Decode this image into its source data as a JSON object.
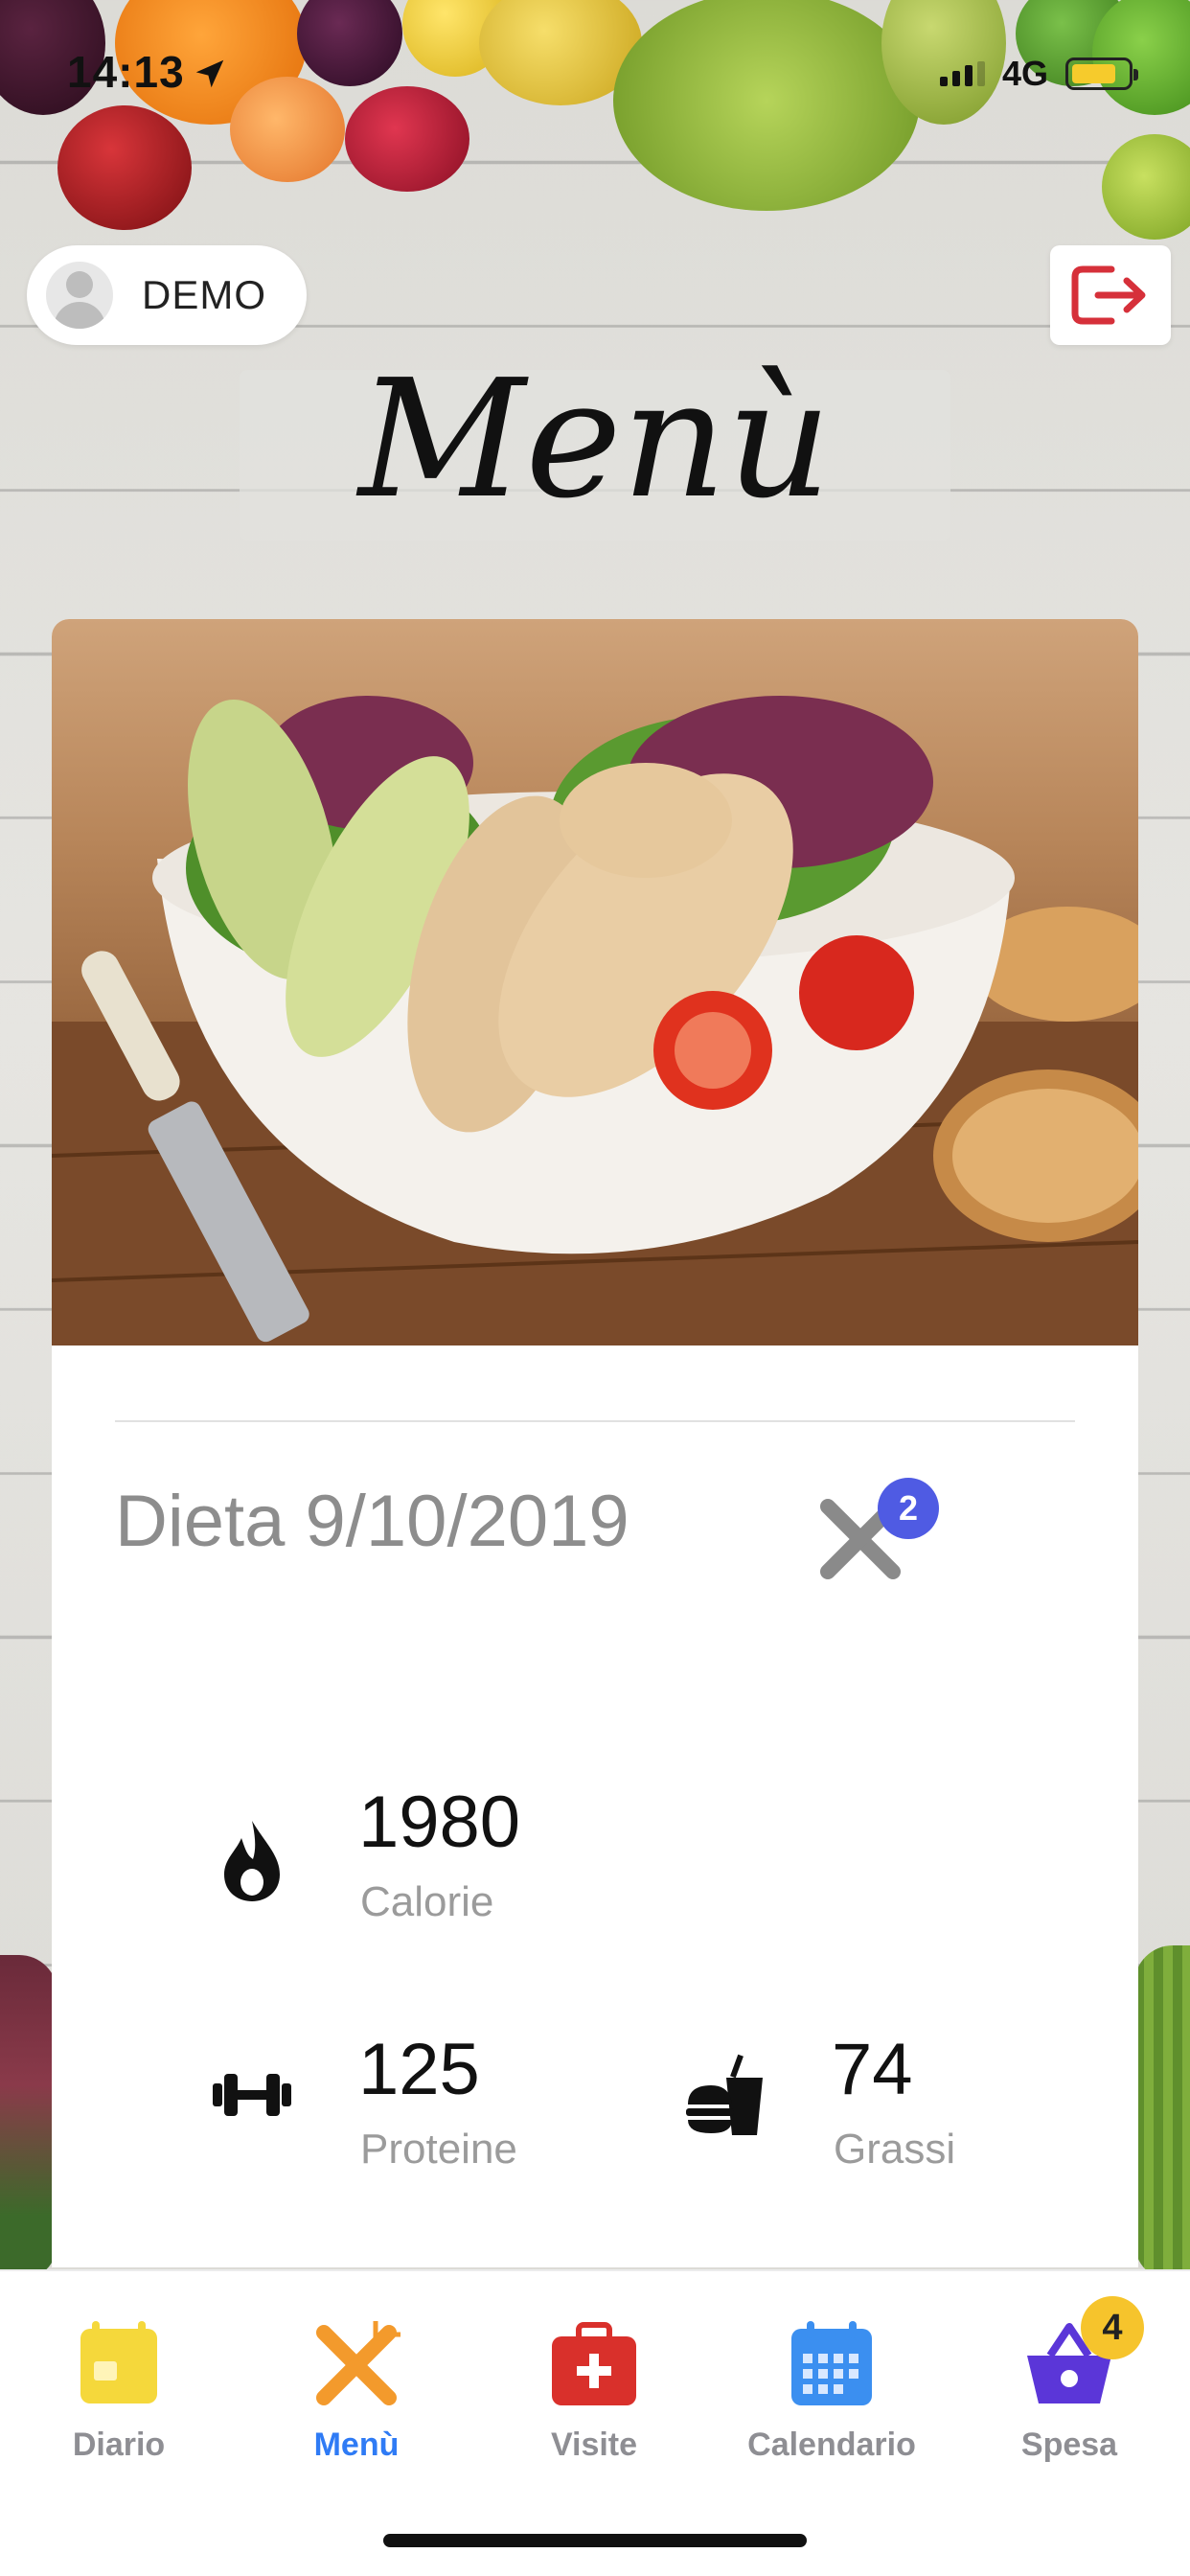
{
  "status_bar": {
    "time": "14:13",
    "network": "4G",
    "battery_level": 0.8,
    "icons": [
      "location-arrow-icon",
      "signal-icon",
      "battery-icon"
    ]
  },
  "header": {
    "user_name": "DEMO",
    "title": "Menù",
    "logout_icon": "logout-icon"
  },
  "card": {
    "diet_title": "Dieta 9/10/2019",
    "meals_count": "2",
    "stats": [
      {
        "value": "1980",
        "label": "Calorie",
        "icon": "flame-icon"
      },
      {
        "value": "125",
        "label": "Proteine",
        "icon": "dumbbell-icon"
      },
      {
        "value": "74",
        "label": "Grassi",
        "icon": "burger-icon"
      }
    ]
  },
  "tabbar": {
    "items": [
      {
        "label": "Diario",
        "icon": "diary-icon",
        "color": "#f5d83b"
      },
      {
        "label": "Menù",
        "icon": "cutlery-icon",
        "color": "#f39a2c",
        "active": true
      },
      {
        "label": "Visite",
        "icon": "medical-bag-icon",
        "color": "#d9302b"
      },
      {
        "label": "Calendario",
        "icon": "calendar-icon",
        "color": "#3b8ff0"
      },
      {
        "label": "Spesa",
        "icon": "basket-icon",
        "color": "#5b36d8",
        "badge": "4"
      }
    ]
  },
  "colors": {
    "accent": "#2f7bf5",
    "badge_blue": "#4f5be3",
    "badge_yellow": "#f6c42c",
    "logout_red": "#d6303a"
  }
}
